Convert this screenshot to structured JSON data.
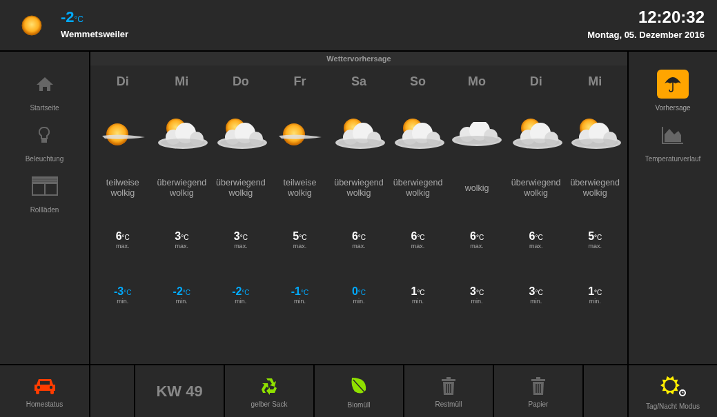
{
  "header": {
    "current": {
      "kind": "sun",
      "value": "-2",
      "unit": "°C",
      "color": "#00aaff"
    },
    "location": "Wemmetsweiler",
    "time": "12:20:32",
    "date": "Montag, 05. Dezember 2016"
  },
  "left_nav": [
    {
      "kind": "house",
      "label": "Startseite",
      "selected": false
    },
    {
      "kind": "bulb",
      "label": "Beleuchtung",
      "selected": false
    },
    {
      "kind": "shutter",
      "label": "Rollläden",
      "selected": false
    }
  ],
  "forecast": {
    "title": "Wettervorhersage",
    "days": [
      {
        "day": "Di",
        "kind": "sun_haze",
        "description": "teilweise wolkig",
        "max": {
          "value": "6",
          "unit": "°C",
          "label": "max.",
          "color": "#ffffff"
        },
        "min": {
          "value": "-3",
          "unit": "°C",
          "label": "min.",
          "color": "#00aaff"
        }
      },
      {
        "day": "Mi",
        "kind": "sun_cloud",
        "description": "überwiegend wolkig",
        "max": {
          "value": "3",
          "unit": "°C",
          "label": "max.",
          "color": "#ffffff"
        },
        "min": {
          "value": "-2",
          "unit": "°C",
          "label": "min.",
          "color": "#00aaff"
        }
      },
      {
        "day": "Do",
        "kind": "sun_cloud",
        "description": "überwiegend wolkig",
        "max": {
          "value": "3",
          "unit": "°C",
          "label": "max.",
          "color": "#ffffff"
        },
        "min": {
          "value": "-2",
          "unit": "°C",
          "label": "min.",
          "color": "#00aaff"
        }
      },
      {
        "day": "Fr",
        "kind": "sun_haze",
        "description": "teilweise wolkig",
        "max": {
          "value": "5",
          "unit": "°C",
          "label": "max.",
          "color": "#ffffff"
        },
        "min": {
          "value": "-1",
          "unit": "°C",
          "label": "min.",
          "color": "#00aaff"
        }
      },
      {
        "day": "Sa",
        "kind": "sun_cloud",
        "description": "überwiegend wolkig",
        "max": {
          "value": "6",
          "unit": "°C",
          "label": "max.",
          "color": "#ffffff"
        },
        "min": {
          "value": "0",
          "unit": "°C",
          "label": "min.",
          "color": "#00aaff"
        }
      },
      {
        "day": "So",
        "kind": "sun_cloud",
        "description": "überwiegend wolkig",
        "max": {
          "value": "6",
          "unit": "°C",
          "label": "max.",
          "color": "#ffffff"
        },
        "min": {
          "value": "1",
          "unit": "°C",
          "label": "min.",
          "color": "#ffffff"
        }
      },
      {
        "day": "Mo",
        "kind": "cloud",
        "description": "wolkig",
        "max": {
          "value": "6",
          "unit": "°C",
          "label": "max.",
          "color": "#ffffff"
        },
        "min": {
          "value": "3",
          "unit": "°C",
          "label": "min.",
          "color": "#ffffff"
        }
      },
      {
        "day": "Di",
        "kind": "sun_cloud",
        "description": "überwiegend wolkig",
        "max": {
          "value": "6",
          "unit": "°C",
          "label": "max.",
          "color": "#ffffff"
        },
        "min": {
          "value": "3",
          "unit": "°C",
          "label": "min.",
          "color": "#ffffff"
        }
      },
      {
        "day": "Mi",
        "kind": "sun_cloud",
        "description": "überwiegend wolkig",
        "max": {
          "value": "5",
          "unit": "°C",
          "label": "max.",
          "color": "#ffffff"
        },
        "min": {
          "value": "1",
          "unit": "°C",
          "label": "min.",
          "color": "#ffffff"
        }
      }
    ]
  },
  "right_nav": [
    {
      "kind": "umbrella",
      "label": "Vorhersage",
      "selected": true
    },
    {
      "kind": "chart",
      "label": "Temperaturverlauf",
      "selected": false
    }
  ],
  "footer": [
    {
      "kind": "car",
      "label": "Homestatus",
      "color": "#ff3c00"
    },
    {
      "kind": "blank"
    },
    {
      "kind": "week",
      "text": "KW 49"
    },
    {
      "kind": "recycle",
      "label": "gelber Sack",
      "color": "#8fe000"
    },
    {
      "kind": "leaf",
      "label": "Biomüll",
      "color": "#8fe000"
    },
    {
      "kind": "trash",
      "label": "Restmüll",
      "color": "#666666"
    },
    {
      "kind": "trash",
      "label": "Papier",
      "color": "#666666"
    },
    {
      "kind": "blank"
    },
    {
      "kind": "sun_clock",
      "label": "Tag/Nacht Modus",
      "color": "#ffee00"
    }
  ]
}
